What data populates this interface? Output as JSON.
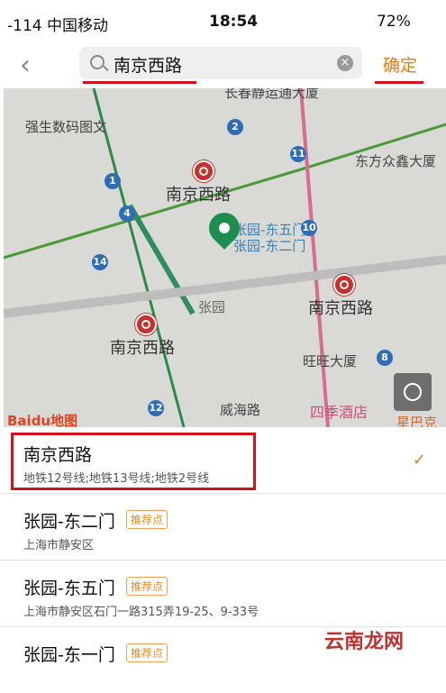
{
  "status_bar": {
    "signal": "-114 中国移动",
    "time": "18:54",
    "battery": "72%"
  },
  "nav": {
    "search_text": "南京西路",
    "confirm_label": "确定"
  },
  "map": {
    "labels": {
      "top_street": "长春静运通大厦",
      "shop": "强生数码图文",
      "station_1": "南京西路",
      "station_2": "南京西路",
      "station_3": "南京西路",
      "building_1": "东方众鑫大厦",
      "poi_1": "张园-东五门",
      "poi_2": "张园-东二门",
      "area": "张园",
      "building_2": "旺旺大厦",
      "road": "威海路",
      "hotel": "四季酒店",
      "corner": "星巴克"
    },
    "badges": [
      "2",
      "11",
      "1",
      "4",
      "10",
      "14",
      "8",
      "12"
    ],
    "logo": "Baidu地图"
  },
  "results": [
    {
      "title": "南京西路",
      "subtitle": "地铁12号线;地铁13号线;地铁2号线",
      "tag": "",
      "selected": true
    },
    {
      "title": "张园-东二门",
      "subtitle": "上海市静安区",
      "tag": "推荐点",
      "selected": false
    },
    {
      "title": "张园-东五门",
      "subtitle": "上海市静安区石门一路315弄19-25、9-33号",
      "tag": "推荐点",
      "selected": false
    },
    {
      "title": "张园-东一门",
      "subtitle": "",
      "tag": "推荐点",
      "selected": false
    }
  ],
  "watermark": "云南龙网"
}
